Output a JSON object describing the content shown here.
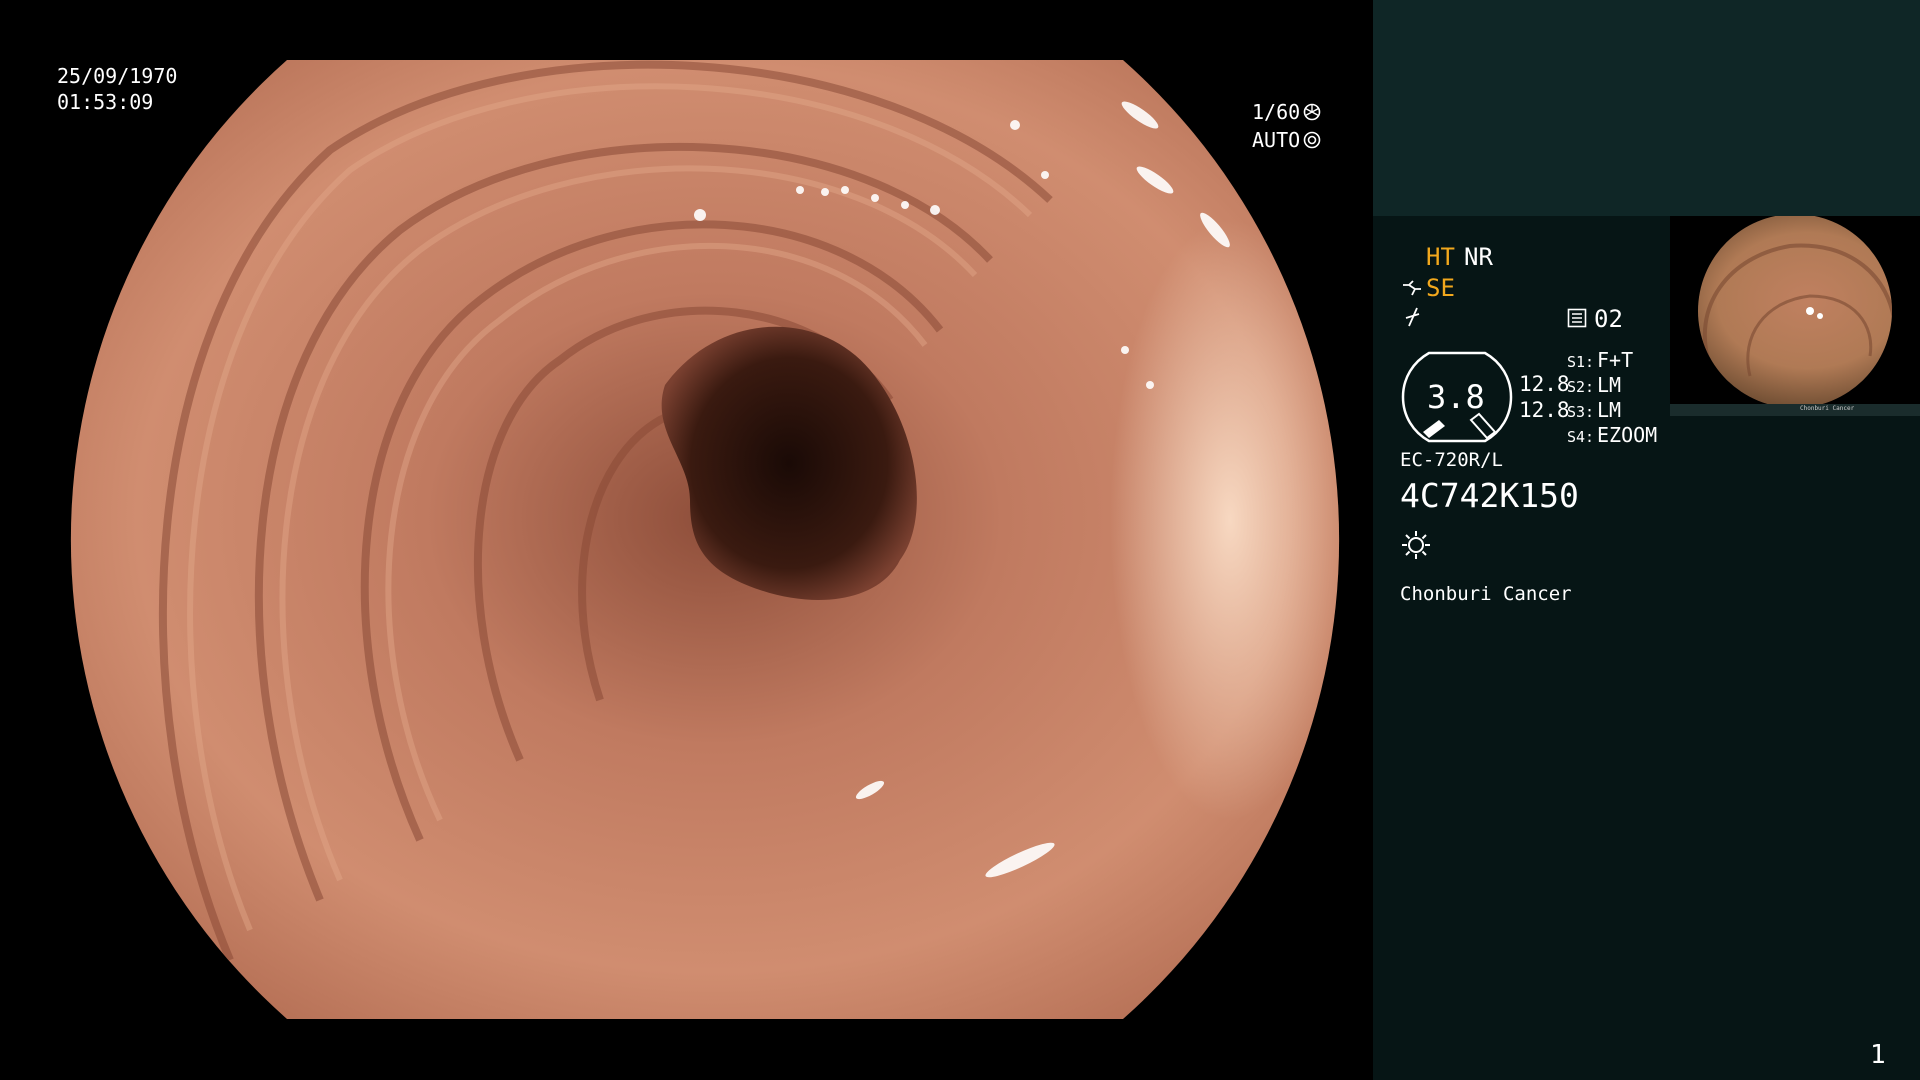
{
  "overlay": {
    "date": "25/09/1970",
    "time": "01:53:09",
    "shutter_speed": "1/60",
    "exposure_mode": "AUTO"
  },
  "panel": {
    "mode_ht": "HT",
    "mode_nr": "NR",
    "mode_se": "SE",
    "memory_channel": "02",
    "zoom_value": "3.8",
    "zoom_ratio_1": "12.8",
    "zoom_ratio_2": "12.8",
    "switches": [
      {
        "key": "S1:",
        "value": "F+T"
      },
      {
        "key": "S2:",
        "value": "LM"
      },
      {
        "key": "S3:",
        "value": "LM"
      },
      {
        "key": "S4:",
        "value": "EZOOM"
      }
    ],
    "scope_model": "EC-720R/L",
    "scope_serial": "4C742K150",
    "institution": "Chonburi Cancer",
    "page_number": "1"
  },
  "colors": {
    "amber": "#f2a81d",
    "panel_bg": "#061515",
    "panel_top": "#0f2626",
    "tissue": "#c88468"
  },
  "icons": [
    "shutter-icon",
    "auto-exposure-icon",
    "scope-angle-icon",
    "enhance-icon",
    "memory-icon",
    "zoom-gauge-icon",
    "light-icon"
  ]
}
